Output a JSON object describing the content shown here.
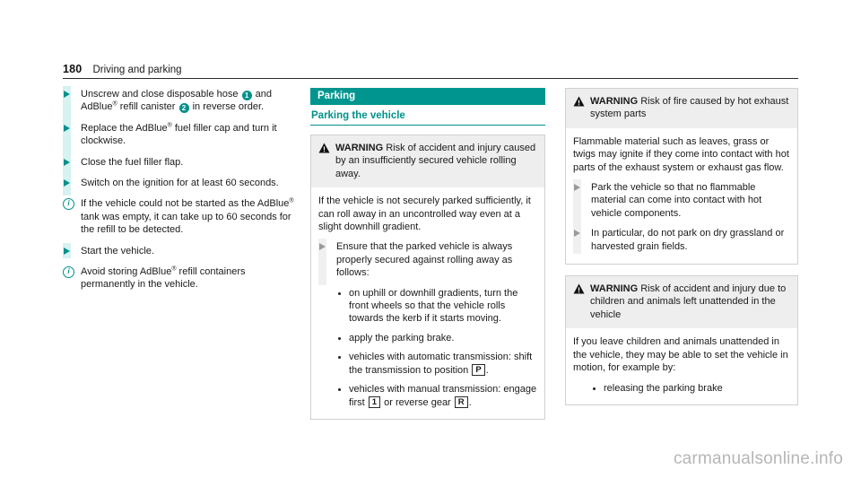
{
  "header": {
    "page_number": "180",
    "title": "Driving and parking"
  },
  "colors": {
    "teal": "#00918b",
    "teal_banner": "#00968f",
    "teal_bar": "#d6f2f1",
    "warn_header_bg": "#eeeeee",
    "gray_arrow": "#9a9a9a",
    "watermark": "#b6b6b6"
  },
  "left_column": {
    "steps": [
      {
        "id": "unscrew-close-hose",
        "parts": [
          {
            "t": "text",
            "v": "Unscrew and close disposable hose "
          },
          {
            "t": "badge",
            "v": "1"
          },
          {
            "t": "text",
            "v": " and AdBlue"
          },
          {
            "t": "sup",
            "v": "®"
          },
          {
            "t": "text",
            "v": " refill canister "
          },
          {
            "t": "badge",
            "v": "2"
          },
          {
            "t": "text",
            "v": " in reverse order."
          }
        ]
      },
      {
        "id": "replace-filler-cap",
        "parts": [
          {
            "t": "text",
            "v": "Replace the AdBlue"
          },
          {
            "t": "sup",
            "v": "®"
          },
          {
            "t": "text",
            "v": " fuel filler cap and turn it clockwise."
          }
        ]
      },
      {
        "id": "close-filler-flap",
        "parts": [
          {
            "t": "text",
            "v": "Close the fuel filler flap."
          }
        ]
      },
      {
        "id": "switch-on-ignition",
        "parts": [
          {
            "t": "text",
            "v": "Switch on the ignition for at least 60 seconds."
          }
        ]
      }
    ],
    "note_1": [
      {
        "t": "text",
        "v": "If the vehicle could not be started as the AdBlue"
      },
      {
        "t": "sup",
        "v": "®"
      },
      {
        "t": "text",
        "v": " tank was empty, it can take up to 60 seconds for the refill to be detected."
      }
    ],
    "step_start_vehicle": [
      {
        "t": "text",
        "v": "Start the vehicle."
      }
    ],
    "note_2": [
      {
        "t": "text",
        "v": "Avoid storing AdBlue"
      },
      {
        "t": "sup",
        "v": "®"
      },
      {
        "t": "text",
        "v": " refill containers permanently in the vehicle."
      }
    ]
  },
  "middle_column": {
    "section_title": "Parking",
    "subsection_title": "Parking the vehicle",
    "warning": {
      "label": "WARNING",
      "headline": " Risk of accident and injury caused by an insufficiently secured vehicle rolling away.",
      "body_paragraph": "If the vehicle is not securely parked sufficiently, it can roll away in an uncontrolled way even at a slight downhill gradient.",
      "step": "Ensure that the parked vehicle is always properly secured against rolling away as follows:",
      "sub_bullets": [
        {
          "id": "turn-front-wheels",
          "parts": [
            {
              "t": "text",
              "v": "on uphill or downhill gradients, turn the front wheels so that the vehicle rolls towards the kerb if it starts moving."
            }
          ]
        },
        {
          "id": "apply-parking-brake",
          "parts": [
            {
              "t": "text",
              "v": "apply the parking brake."
            }
          ]
        },
        {
          "id": "automatic-transmission",
          "parts": [
            {
              "t": "text",
              "v": "vehicles with automatic transmission: shift the transmission to position "
            },
            {
              "t": "key",
              "v": "P"
            },
            {
              "t": "text",
              "v": "."
            }
          ]
        },
        {
          "id": "manual-transmission",
          "parts": [
            {
              "t": "text",
              "v": "vehicles with manual transmission: engage first "
            },
            {
              "t": "key",
              "v": "1"
            },
            {
              "t": "text",
              "v": " or reverse gear "
            },
            {
              "t": "key",
              "v": "R"
            },
            {
              "t": "text",
              "v": "."
            }
          ]
        }
      ]
    }
  },
  "right_column": {
    "warning_fire": {
      "label": "WARNING",
      "headline": " Risk of fire caused by hot exhaust system parts",
      "body_paragraph": "Flammable material such as leaves, grass or twigs may ignite if they come into contact with hot parts of the exhaust system or exhaust gas flow.",
      "steps": [
        {
          "id": "park-away-from-flammable",
          "parts": [
            {
              "t": "text",
              "v": "Park the vehicle so that no flammable material can come into contact with hot vehicle components."
            }
          ]
        },
        {
          "id": "no-dry-grassland",
          "parts": [
            {
              "t": "text",
              "v": "In particular, do not park on dry grassland or harvested grain fields."
            }
          ]
        }
      ]
    },
    "warning_children": {
      "label": "WARNING",
      "headline": " Risk of accident and injury due to children and animals left unattended in the vehicle",
      "body_paragraph": "If you leave children and animals unattended in the vehicle, they may be able to set the vehicle in motion, for example by:",
      "sub_bullets": [
        {
          "id": "releasing-parking-brake",
          "parts": [
            {
              "t": "text",
              "v": "releasing the parking brake"
            }
          ]
        }
      ]
    }
  },
  "watermark": "carmanualsonline.info"
}
